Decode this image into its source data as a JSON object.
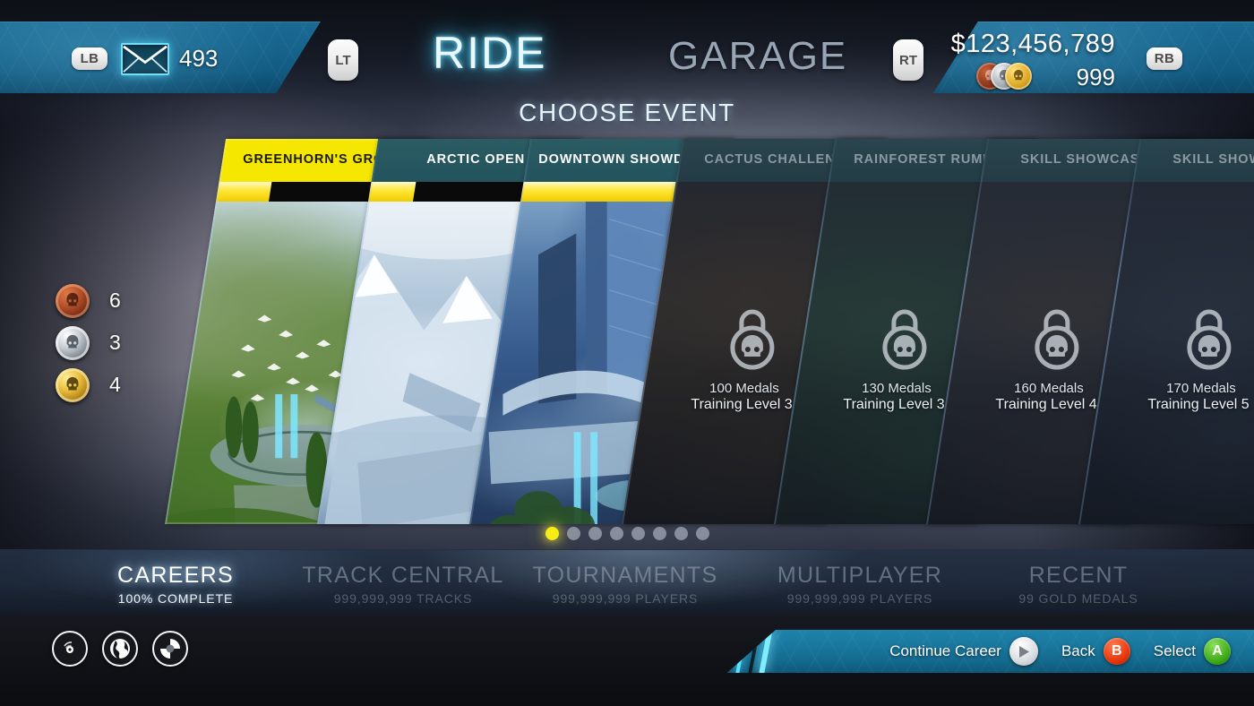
{
  "header": {
    "lb_bumper": "LB",
    "rb_bumper": "RB",
    "lt_trigger": "LT",
    "rt_trigger": "RT",
    "mail_icon": "envelope-icon",
    "mail_count": "493",
    "money": "$123,456,789",
    "medal_count": "999",
    "mode_active": "RIDE",
    "mode_inactive": "GARAGE",
    "subtitle": "CHOOSE EVENT",
    "accent_cyan": "#6fe0ff",
    "bar_blue": "#17658e"
  },
  "medal_sidebar": {
    "items": [
      {
        "type": "bronze",
        "icon": "skull-medal-icon",
        "count": "6",
        "color": "#b4512a"
      },
      {
        "type": "silver",
        "icon": "skull-medal-icon",
        "count": "3",
        "color": "#c6ccd3"
      },
      {
        "type": "gold",
        "icon": "skull-medal-icon",
        "count": "4",
        "color": "#e8bc39"
      }
    ]
  },
  "events": [
    {
      "title": "GREENHORN'S GROVE",
      "state": "selected",
      "locked": false,
      "progress": 26,
      "art": "art-grove"
    },
    {
      "title": "ARCTIC OPEN",
      "state": "unlocked",
      "locked": false,
      "progress": 22,
      "art": "art-arctic"
    },
    {
      "title": "DOWNTOWN SHOWDOWN",
      "state": "unlocked",
      "locked": false,
      "progress": 76,
      "art": "art-downtown"
    },
    {
      "title": "CACTUS CHALLENGE",
      "state": "locked",
      "locked": true,
      "lock_icon": "lock-skull-icon",
      "requirement": "100 Medals",
      "level": "Training Level  3",
      "art": "art-cactus"
    },
    {
      "title": "RAINFOREST RUMBLE",
      "state": "locked",
      "locked": true,
      "lock_icon": "lock-skull-icon",
      "requirement": "130 Medals",
      "level": "Training Level 3",
      "art": "art-rain"
    },
    {
      "title": "SKILL SHOWCASE",
      "state": "locked",
      "locked": true,
      "lock_icon": "lock-skull-icon",
      "requirement": "160 Medals",
      "level": "Training Level  4",
      "art": "art-skill1"
    },
    {
      "title": "SKILL SHOWCASE",
      "state": "locked",
      "locked": true,
      "lock_icon": "lock-skull-icon",
      "requirement": "170 Medals",
      "level": "Training Level  5",
      "art": "art-skill2"
    }
  ],
  "pagination": {
    "total": 8,
    "active_index": 0,
    "active_color": "#f7ec14"
  },
  "bottom_nav": {
    "items": [
      {
        "label": "CAREERS",
        "sub": "100% COMPLETE",
        "active": true
      },
      {
        "label": "TRACK CENTRAL",
        "sub": "999,999,999 TRACKS",
        "active": false
      },
      {
        "label": "TOURNAMENTS",
        "sub": "999,999,999 PLAYERS",
        "active": false
      },
      {
        "label": "MULTIPLAYER",
        "sub": "999,999,999 PLAYERS",
        "active": false
      },
      {
        "label": "RECENT",
        "sub": "99 GOLD MEDALS",
        "active": false
      }
    ]
  },
  "status_icons": [
    {
      "name": "signal-icon"
    },
    {
      "name": "globe-icon"
    },
    {
      "name": "sync-icon"
    }
  ],
  "prompts": [
    {
      "label": "Continue Career",
      "glyph": "play-icon",
      "glyph_text": "",
      "kind": "play"
    },
    {
      "label": "Back",
      "glyph": "b-button-icon",
      "glyph_text": "B",
      "kind": "b"
    },
    {
      "label": "Select",
      "glyph": "a-button-icon",
      "glyph_text": "A",
      "kind": "a"
    }
  ]
}
